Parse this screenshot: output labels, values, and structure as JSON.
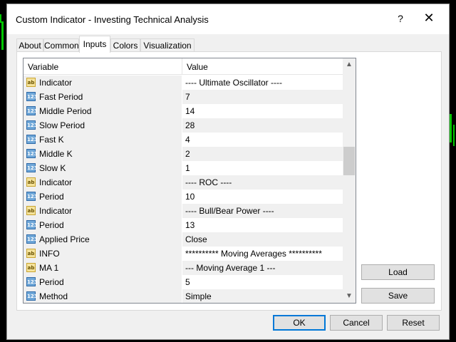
{
  "window": {
    "title": "Custom Indicator - Investing Technical Analysis",
    "help_label": "?",
    "close_label": "✕"
  },
  "tabs": [
    {
      "label": "About"
    },
    {
      "label": "Common"
    },
    {
      "label": "Inputs"
    },
    {
      "label": "Colors"
    },
    {
      "label": "Visualization"
    }
  ],
  "active_tab": "Inputs",
  "grid": {
    "headers": {
      "variable": "Variable",
      "value": "Value"
    },
    "rows": [
      {
        "type": "ab",
        "variable": "Indicator",
        "value": "---- Ultimate Oscillator ----"
      },
      {
        "type": "123",
        "variable": "Fast Period",
        "value": "7"
      },
      {
        "type": "123",
        "variable": "Middle Period",
        "value": "14"
      },
      {
        "type": "123",
        "variable": "Slow Period",
        "value": "28"
      },
      {
        "type": "123",
        "variable": "Fast K",
        "value": "4"
      },
      {
        "type": "123",
        "variable": "Middle K",
        "value": "2"
      },
      {
        "type": "123",
        "variable": "Slow K",
        "value": "1"
      },
      {
        "type": "ab",
        "variable": "Indicator",
        "value": "---- ROC ----"
      },
      {
        "type": "123",
        "variable": "Period",
        "value": "10"
      },
      {
        "type": "ab",
        "variable": "Indicator",
        "value": "---- Bull/Bear Power ----"
      },
      {
        "type": "123",
        "variable": "Period",
        "value": "13"
      },
      {
        "type": "123",
        "variable": "Applied Price",
        "value": "Close"
      },
      {
        "type": "ab",
        "variable": "INFO",
        "value": "********** Moving Averages **********"
      },
      {
        "type": "ab",
        "variable": "MA 1",
        "value": "--- Moving Average 1 ---"
      },
      {
        "type": "123",
        "variable": "Period",
        "value": "5"
      },
      {
        "type": "123",
        "variable": "Method",
        "value": "Simple"
      }
    ],
    "scroll_up": "▲",
    "scroll_down": "▼"
  },
  "side_buttons": {
    "load": "Load",
    "save": "Save"
  },
  "footer_buttons": {
    "ok": "OK",
    "cancel": "Cancel",
    "reset": "Reset"
  },
  "colors": {
    "accent": "#0078d7",
    "chart_green": "#00c800"
  }
}
